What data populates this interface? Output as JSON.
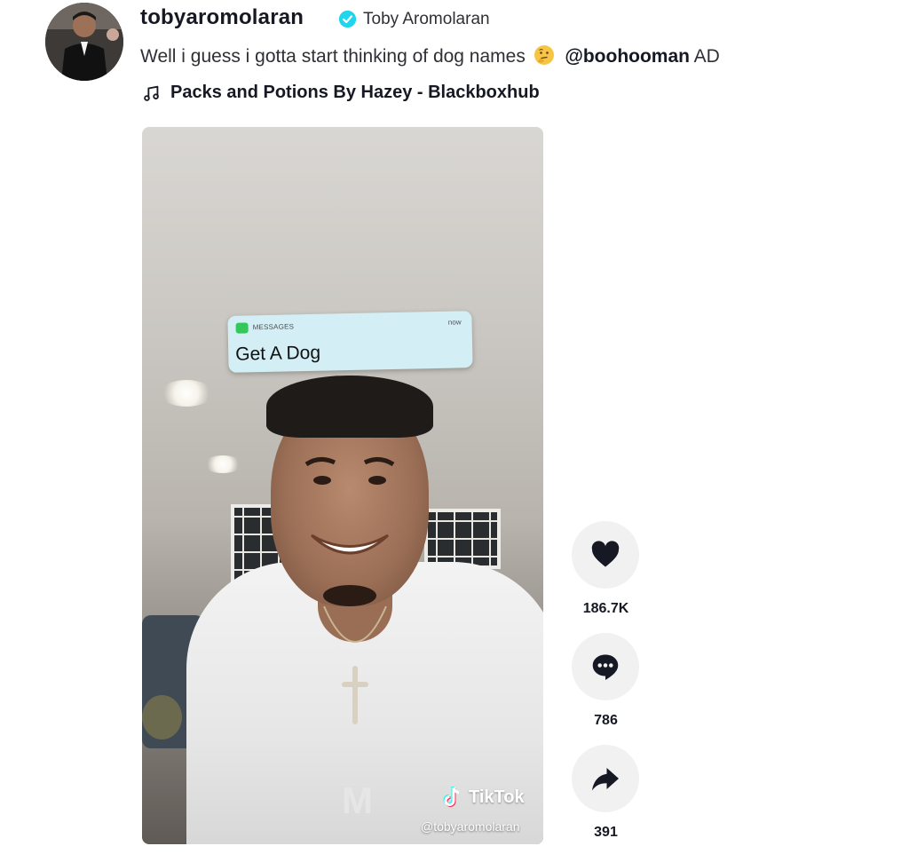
{
  "author": {
    "username": "tobyaromolaran",
    "display_name": "Toby Aromolaran",
    "verified": true
  },
  "caption": {
    "text": "Well i guess i gotta start thinking of dog names",
    "emoji": "thinking-face-emoji",
    "mention": "@boohooman",
    "suffix": "AD"
  },
  "music": {
    "title": "Packs and Potions By Hazey - Blackboxhub"
  },
  "video": {
    "notification": {
      "app": "MESSAGES",
      "time": "now",
      "text": "Get A Dog"
    },
    "watermark_brand": "TikTok",
    "watermark_handle": "@tobyaromolaran"
  },
  "actions": {
    "like_count": "186.7K",
    "comment_count": "786",
    "share_count": "391"
  },
  "colors": {
    "verified_blue": "#20d5ec",
    "text_primary": "#161823",
    "action_bg": "#f1f1f2",
    "notification_bg": "#d3eef4"
  }
}
